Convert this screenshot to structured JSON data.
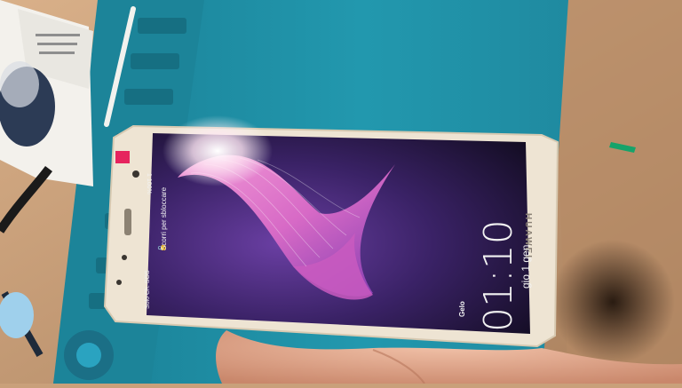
{
  "lockscreen": {
    "status_text": "Solo Ch. SOS",
    "battery_text": "1 100%",
    "unlock_hint": "Scorri per sbloccare",
    "weather_label": "Gelo",
    "time": "01:10",
    "date": "gio 1 gen"
  },
  "device": {
    "brand": "HUAWEI",
    "body_color": "#efe6d6",
    "screen_color": "#1a1233"
  },
  "colors": {
    "mat": "#1e8fa6",
    "desk": "#c49a72",
    "wallpaper_pink": "#e37ad0",
    "wallpaper_violet": "#5b2c8f"
  }
}
